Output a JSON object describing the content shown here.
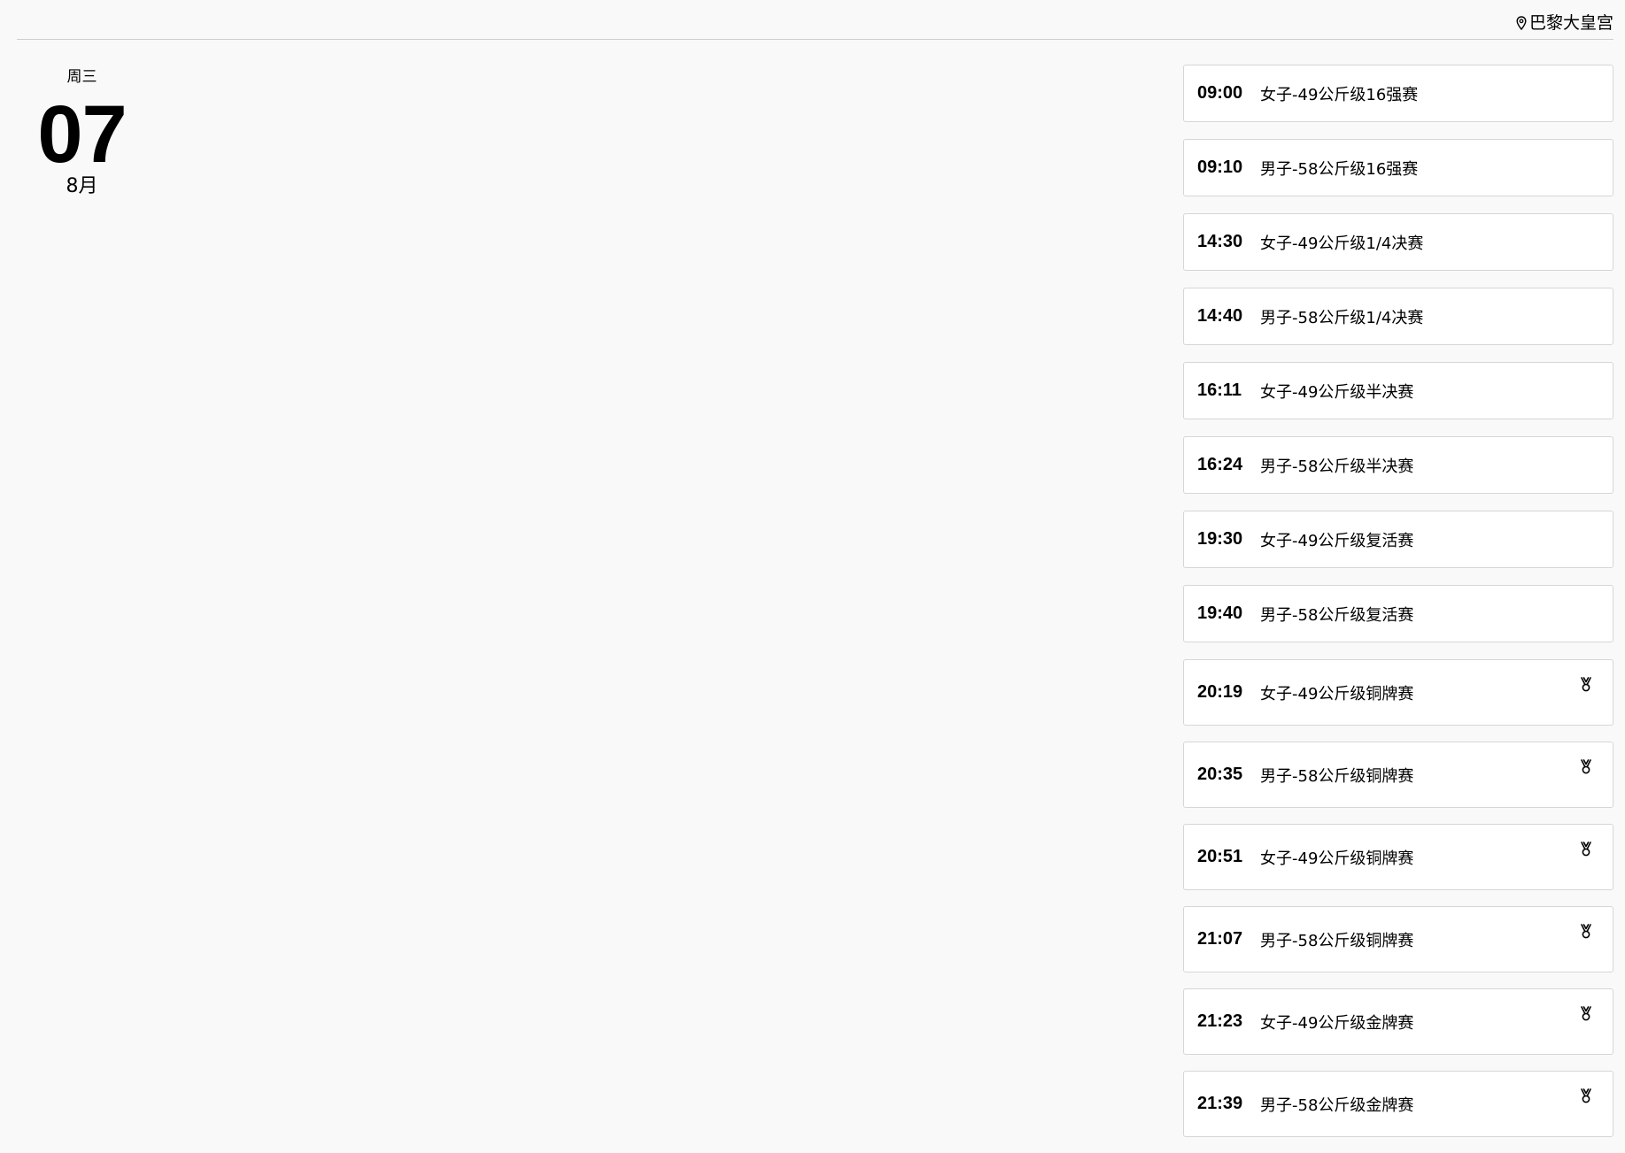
{
  "header": {
    "venue_icon": "location-pin-icon",
    "venue": "巴黎大皇宫"
  },
  "date": {
    "weekday": "周三",
    "day": "07",
    "month": "8月"
  },
  "events": [
    {
      "time": "09:00",
      "name": "女子-49公斤级16强赛",
      "medal": false
    },
    {
      "time": "09:10",
      "name": "男子-58公斤级16强赛",
      "medal": false
    },
    {
      "time": "14:30",
      "name": "女子-49公斤级1/4决赛",
      "medal": false
    },
    {
      "time": "14:40",
      "name": "男子-58公斤级1/4决赛",
      "medal": false
    },
    {
      "time": "16:11",
      "name": "女子-49公斤级半决赛",
      "medal": false
    },
    {
      "time": "16:24",
      "name": "男子-58公斤级半决赛",
      "medal": false
    },
    {
      "time": "19:30",
      "name": "女子-49公斤级复活赛",
      "medal": false
    },
    {
      "time": "19:40",
      "name": "男子-58公斤级复活赛",
      "medal": false
    },
    {
      "time": "20:19",
      "name": "女子-49公斤级铜牌赛",
      "medal": true
    },
    {
      "time": "20:35",
      "name": "男子-58公斤级铜牌赛",
      "medal": true
    },
    {
      "time": "20:51",
      "name": "女子-49公斤级铜牌赛",
      "medal": true
    },
    {
      "time": "21:07",
      "name": "男子-58公斤级铜牌赛",
      "medal": true
    },
    {
      "time": "21:23",
      "name": "女子-49公斤级金牌赛",
      "medal": true
    },
    {
      "time": "21:39",
      "name": "男子-58公斤级金牌赛",
      "medal": true
    }
  ]
}
